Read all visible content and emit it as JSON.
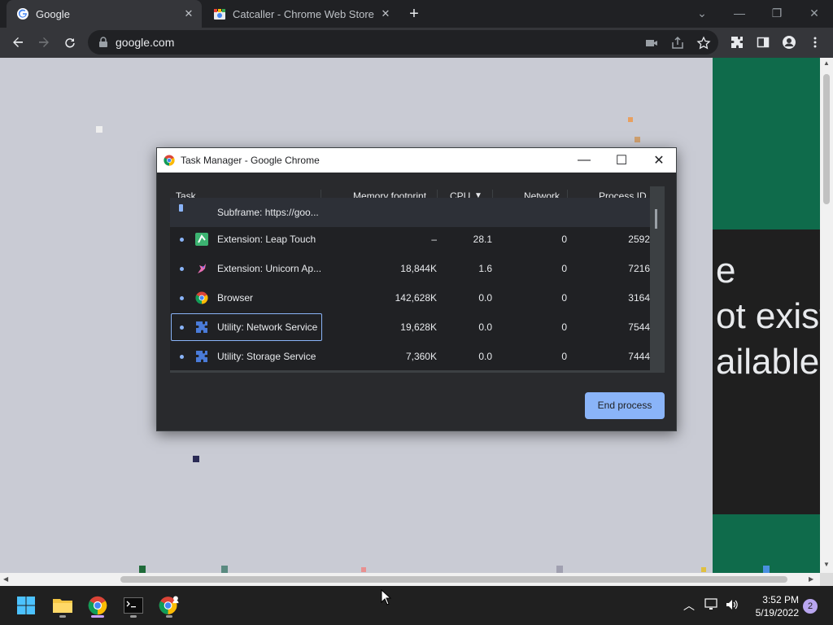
{
  "browser": {
    "tabs": [
      {
        "title": "Google",
        "active": true
      },
      {
        "title": "Catcaller - Chrome Web Store",
        "active": false
      }
    ],
    "address": "google.com"
  },
  "page": {
    "partial_text": [
      "e",
      "ot exist",
      "ailable."
    ]
  },
  "task_manager": {
    "window_title": "Task Manager - Google Chrome",
    "columns": [
      "Task",
      "Memory footprint",
      "CPU",
      "Network",
      "Process ID"
    ],
    "sort_indicator": "▼",
    "rows": [
      {
        "task": "Subframe: https://goo...",
        "memory": "",
        "cpu": "",
        "network": "",
        "pid": "",
        "icon": "frame-icon"
      },
      {
        "task": "Extension: Leap Touch",
        "memory": "–",
        "cpu": "28.1",
        "network": "0",
        "pid": "2592",
        "icon": "leap-touch-icon"
      },
      {
        "task": "Extension: Unicorn Ap...",
        "memory": "18,844K",
        "cpu": "1.6",
        "network": "0",
        "pid": "7216",
        "icon": "unicorn-icon"
      },
      {
        "task": "Browser",
        "memory": "142,628K",
        "cpu": "0.0",
        "network": "0",
        "pid": "3164",
        "icon": "chrome-icon"
      },
      {
        "task": "Utility: Network Service",
        "memory": "19,628K",
        "cpu": "0.0",
        "network": "0",
        "pid": "7544",
        "icon": "puzzle-icon"
      },
      {
        "task": "Utility: Storage Service",
        "memory": "7,360K",
        "cpu": "0.0",
        "network": "0",
        "pid": "7444",
        "icon": "puzzle-icon"
      }
    ],
    "end_process_label": "End process"
  },
  "taskbar": {
    "time": "3:52 PM",
    "date": "5/19/2022",
    "notification_count": "2"
  },
  "colors": {
    "accent": "#8ab4f8",
    "dialog_bg": "#292a2d",
    "page_bg": "#c9cbd4",
    "green_panel": "#0f6b4b"
  }
}
